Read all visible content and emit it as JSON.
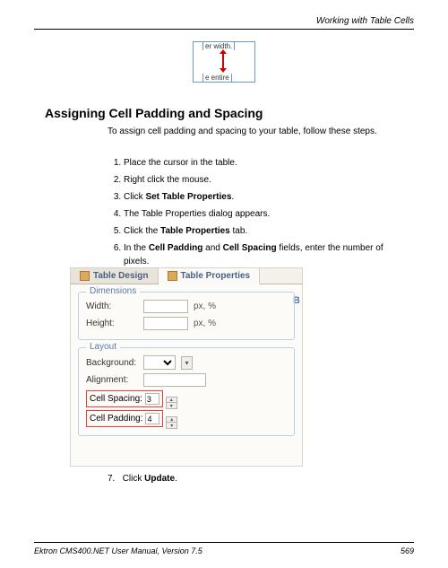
{
  "header": {
    "title": "Working with Table Cells"
  },
  "illustration": {
    "top_label": "er width.",
    "bottom_label": "e entire"
  },
  "section": {
    "heading": "Assigning Cell Padding and Spacing",
    "intro": "To assign cell padding and spacing to your table, follow these steps.",
    "steps": [
      {
        "text": "Place the cursor in the table."
      },
      {
        "text": "Right click the mouse."
      },
      {
        "prefix": "Click ",
        "bold": "Set Table Properties",
        "suffix": "."
      },
      {
        "text": "The Table Properties dialog appears."
      },
      {
        "prefix": "Click the ",
        "bold": "Table Properties",
        "suffix": " tab."
      },
      {
        "prefix": "In the ",
        "bold": "Cell Padding",
        "mid": " and ",
        "bold2": "Cell Spacing",
        "suffix": " fields, enter the number of pixels."
      }
    ],
    "step7": {
      "num": "7.",
      "prefix": "Click ",
      "bold": "Update",
      "suffix": "."
    }
  },
  "dialog": {
    "tabs": {
      "design": "Table Design",
      "properties": "Table Properties"
    },
    "right_group_initial": "B",
    "groups": {
      "dimensions": {
        "title": "Dimensions",
        "width_label": "Width:",
        "height_label": "Height:",
        "units": "px, %"
      },
      "layout": {
        "title": "Layout",
        "background_label": "Background:",
        "alignment_label": "Alignment:",
        "spacing_label": "Cell Spacing:",
        "padding_label": "Cell Padding:",
        "spacing_value": "3",
        "padding_value": "4"
      }
    }
  },
  "footer": {
    "manual": "Ektron CMS400.NET User Manual, Version 7.5",
    "page": "569"
  }
}
